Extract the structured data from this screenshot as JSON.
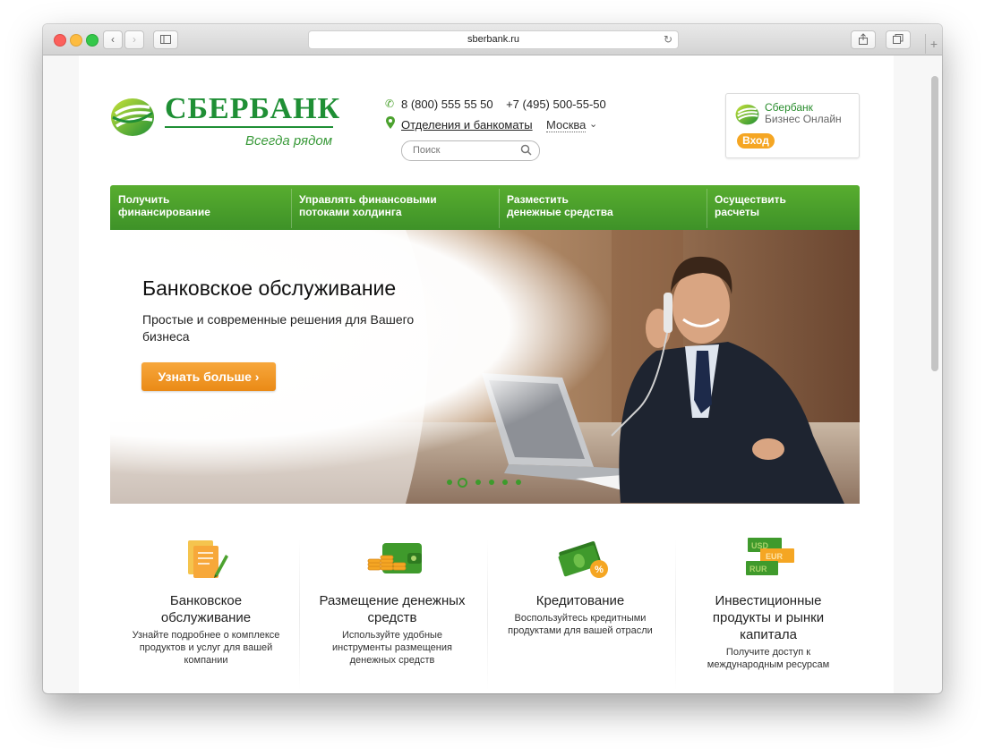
{
  "browser": {
    "url": "sberbank.ru"
  },
  "header": {
    "logo_text": "СБЕРБАНК",
    "slogan": "Всегда рядом",
    "phone1": "8 (800) 555 55 50",
    "phone2": "+7 (495) 500-55-50",
    "branches_link": "Отделения и банкоматы",
    "city": "Москва",
    "search_placeholder": "Поиск"
  },
  "business_online": {
    "title": "Сбербанк",
    "subtitle": "Бизнес Онлайн",
    "login_label": "Вход"
  },
  "nav": {
    "items": [
      {
        "line1": "Получить",
        "line2": "финансирование"
      },
      {
        "line1": "Управлять финансовыми",
        "line2": "потоками холдинга"
      },
      {
        "line1": "Разместить",
        "line2": "денежные средства"
      },
      {
        "line1": "Осуществить",
        "line2": "расчеты"
      }
    ]
  },
  "hero": {
    "title": "Банковское обслуживание",
    "subtitle": "Простые и современные решения для Вашего бизнеса",
    "button": "Узнать больше  ›",
    "slides_count": 6,
    "active_slide": 2
  },
  "features": [
    {
      "title_lines": [
        "Банковское",
        "обслуживание"
      ],
      "desc_lines": [
        "Узнайте подробнее о комплексе",
        "продуктов и услуг для вашей",
        "компании"
      ],
      "icon": "document-pen-icon"
    },
    {
      "title_lines": [
        "Размещение денежных",
        "средств"
      ],
      "desc_lines": [
        "Используйте удобные",
        "инструменты размещения",
        "денежных средств"
      ],
      "icon": "wallet-coins-icon"
    },
    {
      "title_lines": [
        "Кредитование"
      ],
      "desc_lines": [
        "Воспользуйтесь кредитными",
        "продуктами для вашей отрасли"
      ],
      "icon": "money-percent-icon"
    },
    {
      "title_lines": [
        "Инвестиционные",
        "продукты и рынки",
        "капитала"
      ],
      "desc_lines": [
        "Получите доступ к",
        "международным ресурсам"
      ],
      "icon": "currency-bills-icon",
      "currency_labels": [
        "USD",
        "EUR",
        "RUR"
      ]
    }
  ],
  "colors": {
    "brand_green": "#1f8f35",
    "nav_green": "#4ca22f",
    "accent_orange": "#f5a623"
  }
}
